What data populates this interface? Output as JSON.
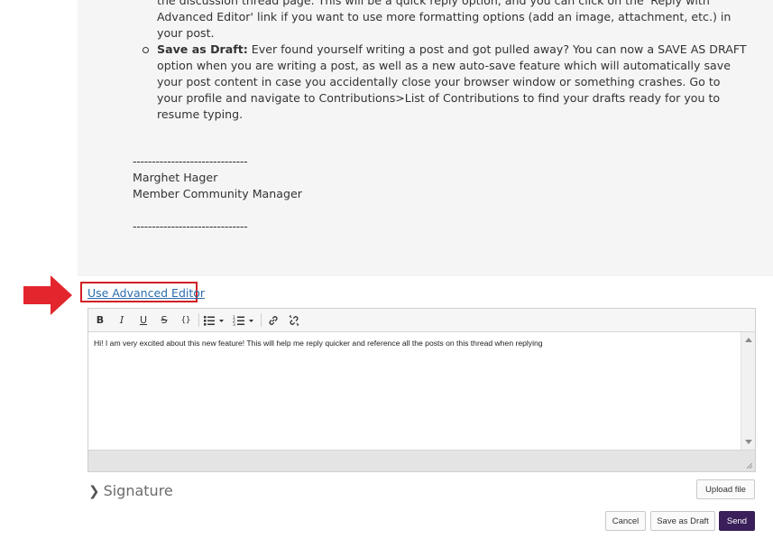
{
  "post": {
    "item1_lines": [
      "the discussion thread page. This will be a quick reply option, and you can click on the 'Reply with",
      "Advanced Editor' link if you want to use more formatting options (add an image, attachment, etc.) in",
      "your post."
    ],
    "item2_title": "Save as Draft:",
    "item2_lines": [
      " Ever found yourself writing a post and got pulled away? You can now a SAVE AS DRAFT",
      "option when you are writing a post, as well as a new auto-save feature which will automatically save",
      "your post content in case you accidentally close your browser window or something crashes. Go to",
      "your profile and navigate to Contributions>List of Contributions to find your drafts ready for you to",
      "resume typing."
    ],
    "divider": "------------------------------",
    "author_name": "Marghet Hager",
    "author_title": "Member Community Manager"
  },
  "advanced_editor_link": "Use Advanced Editor",
  "toolbar": {
    "bold": "B",
    "italic": "I",
    "underline": "U",
    "strike": "S",
    "code": "{}",
    "bullets_icon": "bulleted-list-icon",
    "numbers_icon": "numbered-list-icon",
    "link_icon": "link-icon",
    "unlink_icon": "unlink-icon"
  },
  "editor": {
    "value": "Hi! I am very excited about this new feature! This will help me reply quicker and reference all the posts on this thread when replying"
  },
  "signature": {
    "label": "Signature"
  },
  "buttons": {
    "upload": "Upload file",
    "cancel": "Cancel",
    "save_draft": "Save as Draft",
    "send": "Send"
  },
  "colors": {
    "accent_send": "#3a1f5a",
    "highlight_red": "#d11f26",
    "link_blue": "#2b6cab"
  }
}
